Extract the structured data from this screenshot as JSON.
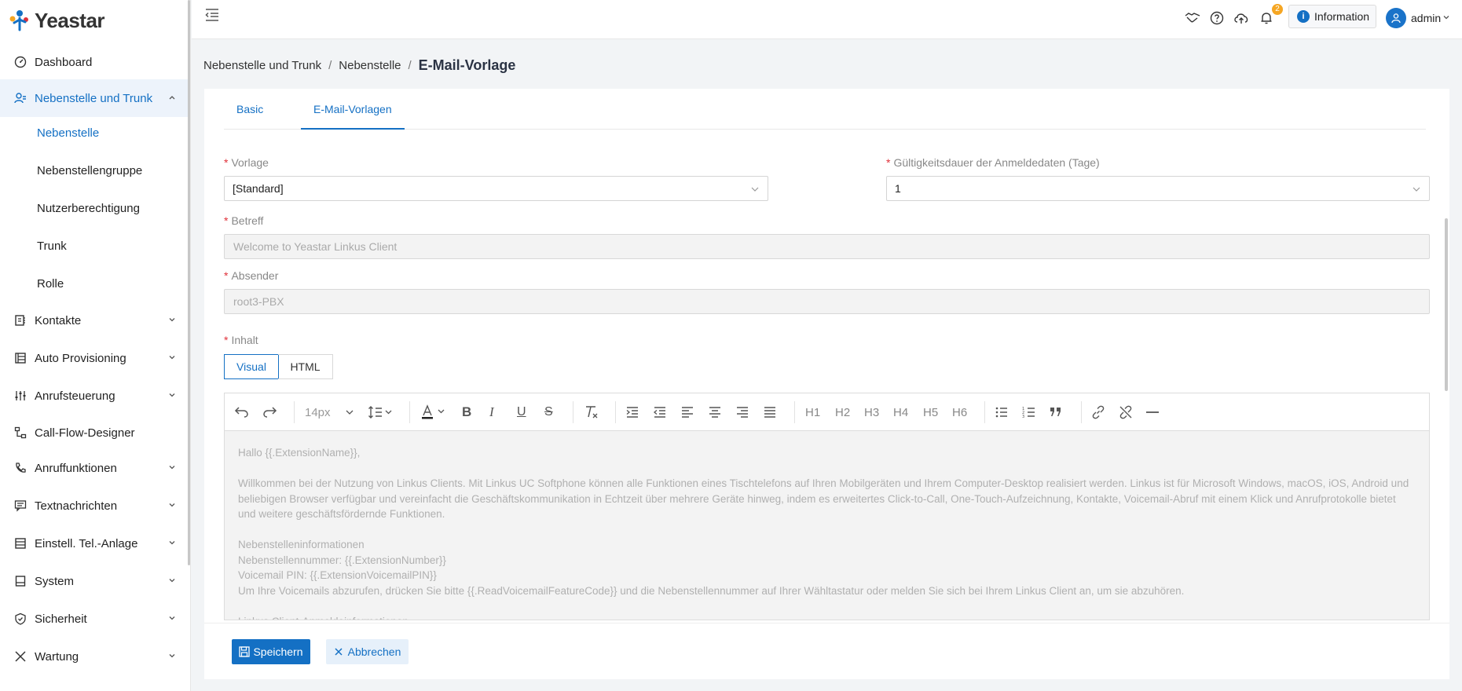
{
  "brand": {
    "name": "Yeastar",
    "accent": "#1470c4"
  },
  "sidebar": {
    "items": [
      {
        "label": "Dashboard",
        "icon": "dashboard-icon"
      },
      {
        "label": "Nebenstelle und Trunk",
        "icon": "users-icon"
      },
      {
        "label": "Kontakte",
        "icon": "contacts-icon"
      },
      {
        "label": "Auto Provisioning",
        "icon": "provisioning-icon"
      },
      {
        "label": "Anrufsteuerung",
        "icon": "call-control-icon"
      },
      {
        "label": "Call-Flow-Designer",
        "icon": "flow-icon"
      },
      {
        "label": "Anruffunktionen",
        "icon": "phone-icon"
      },
      {
        "label": "Textnachrichten",
        "icon": "message-icon"
      },
      {
        "label": "Einstell. Tel.-Anlage",
        "icon": "pbx-settings-icon"
      },
      {
        "label": "System",
        "icon": "system-icon"
      },
      {
        "label": "Sicherheit",
        "icon": "shield-icon"
      },
      {
        "label": "Wartung",
        "icon": "tools-icon"
      }
    ],
    "subitems": [
      {
        "label": "Nebenstelle"
      },
      {
        "label": "Nebenstellengruppe"
      },
      {
        "label": "Nutzerberechtigung"
      },
      {
        "label": "Trunk"
      },
      {
        "label": "Rolle"
      }
    ]
  },
  "header": {
    "notification_count": "2",
    "info_label": "Information",
    "user_name": "admin"
  },
  "breadcrumb": {
    "level1": "Nebenstelle und Trunk",
    "level2": "Nebenstelle",
    "current": "E-Mail-Vorlage"
  },
  "tabs": [
    {
      "label": "Basic"
    },
    {
      "label": "E-Mail-Vorlagen"
    }
  ],
  "form": {
    "template_label": "Vorlage",
    "template_value": "[Standard]",
    "validity_label": "Gültigkeitsdauer der Anmeldedaten (Tage)",
    "validity_value": "1",
    "subject_label": "Betreff",
    "subject_value": "Welcome to Yeastar Linkus Client",
    "sender_label": "Absender",
    "sender_value": "root3-PBX",
    "content_label": "Inhalt",
    "mode_visual": "Visual",
    "mode_html": "HTML"
  },
  "editor": {
    "font_size": "14px",
    "headings": [
      "H1",
      "H2",
      "H3",
      "H4",
      "H5",
      "H6"
    ],
    "lines": [
      "Hallo {{.ExtensionName}},",
      "",
      "Willkommen bei der Nutzung von Linkus Clients. Mit Linkus UC Softphone können alle Funktionen eines Tischtelefons auf Ihren Mobilgeräten und Ihrem Computer-Desktop realisiert werden. Linkus ist für Microsoft Windows, macOS, iOS, Android und beliebigen Browser verfügbar und vereinfacht die Geschäftskommunikation in Echtzeit über mehrere Geräte hinweg, indem es erweitertes Click-to-Call, One-Touch-Aufzeichnung, Kontakte, Voicemail-Abruf mit einem Klick und Anrufprotokolle bietet und weitere geschäftsfördernde Funktionen.",
      "",
      "Nebenstelleninformationen",
      "Nebenstellennummer: {{.ExtensionNumber}}",
      "Voicemail PIN: {{.ExtensionVoicemailPIN}}",
      "Um Ihre Voicemails abzurufen, drücken Sie bitte {{.ReadVoicemailFeatureCode}} und die Nebenstellennummer auf Ihrer Wähltastatur oder melden Sie sich bei Ihrem Linkus Client an, um sie abzuhören.",
      "",
      "Linkus Client-Anmeldeinformationen"
    ]
  },
  "actions": {
    "save": "Speichern",
    "cancel": "Abbrechen"
  }
}
